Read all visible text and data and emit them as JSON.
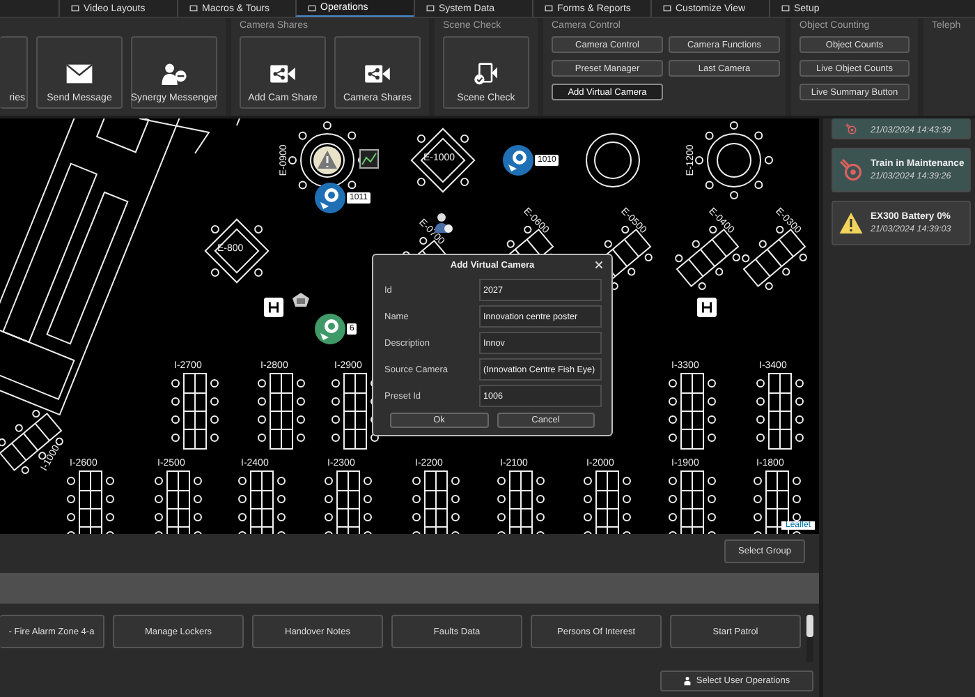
{
  "tabs": [
    {
      "label": "Video Layouts",
      "selected": false
    },
    {
      "label": "Macros & Tours",
      "selected": false
    },
    {
      "label": "Operations",
      "selected": true
    },
    {
      "label": "System Data",
      "selected": false
    },
    {
      "label": "Forms & Reports",
      "selected": false
    },
    {
      "label": "Customize View",
      "selected": false
    },
    {
      "label": "Setup",
      "selected": false
    }
  ],
  "ribbon": [
    {
      "kind": "large",
      "buttons": [
        {
          "label": "ries"
        },
        {
          "label": "Send Message"
        },
        {
          "label": "Synergy Messenger"
        }
      ]
    },
    {
      "kind": "large",
      "title": "Camera Shares",
      "buttons": [
        {
          "label": "Add Cam Share"
        },
        {
          "label": "Camera Shares"
        }
      ]
    },
    {
      "kind": "large",
      "title": "Scene Check",
      "buttons": [
        {
          "label": "Scene Check"
        }
      ]
    },
    {
      "kind": "small",
      "title": "Camera Control",
      "buttons": [
        {
          "label": "Camera Control",
          "selected": false
        },
        {
          "label": "Camera Functions",
          "selected": false
        },
        {
          "label": "Preset Manager",
          "selected": false
        },
        {
          "label": "Last Camera",
          "selected": false
        },
        {
          "label": "Add Virtual Camera",
          "selected": true
        }
      ]
    },
    {
      "kind": "column",
      "title": "Object Counting",
      "buttons": [
        {
          "label": "Object Counts",
          "selected": false
        },
        {
          "label": "Live Object Counts",
          "selected": false
        },
        {
          "label": "Live Summary Button",
          "selected": false
        }
      ]
    },
    {
      "kind": "column",
      "title": "Teleph"
    }
  ],
  "map": {
    "tables": [
      {
        "kind": "round",
        "label": "E-0900"
      },
      {
        "kind": "diamond",
        "label": "E-1000"
      },
      {
        "kind": "round",
        "label": "E-1200"
      },
      {
        "kind": "diamond",
        "label": "E-800"
      },
      {
        "kind": "angled",
        "label": "E-0700"
      },
      {
        "kind": "angled",
        "label": "E-0600"
      },
      {
        "kind": "angled",
        "label": "E-0500"
      },
      {
        "kind": "angled",
        "label": "E-0400"
      },
      {
        "kind": "angled",
        "label": "E-0300"
      },
      {
        "kind": "long",
        "label": "I-2700"
      },
      {
        "kind": "long",
        "label": "I-2800"
      },
      {
        "kind": "long",
        "label": "I-2900"
      },
      {
        "kind": "long",
        "label": "I-3300"
      },
      {
        "kind": "long",
        "label": "I-3400"
      },
      {
        "kind": "long",
        "label": "I-2600"
      },
      {
        "kind": "long",
        "label": "I-2500"
      },
      {
        "kind": "long",
        "label": "I-2400"
      },
      {
        "kind": "long",
        "label": "I-2300"
      },
      {
        "kind": "long",
        "label": "I-2200"
      },
      {
        "kind": "long",
        "label": "I-2100"
      },
      {
        "kind": "long",
        "label": "I-2000"
      },
      {
        "kind": "long",
        "label": "I-1900"
      },
      {
        "kind": "long",
        "label": "I-1800"
      },
      {
        "kind": "slanted",
        "label": "I-1000"
      }
    ],
    "pins": [
      {
        "label": "1011",
        "color": "#1f6fb5"
      },
      {
        "label": "1010",
        "color": "#1f6fb5"
      },
      {
        "label": "6",
        "color": "#3f9a68"
      }
    ],
    "attribution": "Leaflet"
  },
  "dialog": {
    "title": "Add Virtual Camera",
    "fields": [
      {
        "label": "Id",
        "value": "2027"
      },
      {
        "label": "Name",
        "value": "Innovation centre poster"
      },
      {
        "label": "Description",
        "value": "Innov"
      },
      {
        "label": "Source Camera",
        "value": "(Innovation Centre Fish Eye)"
      },
      {
        "label": "Preset Id",
        "value": "1006"
      }
    ],
    "buttons": [
      "Ok",
      "Cancel"
    ]
  },
  "group_button": "Select Group",
  "operations": [
    "- Fire Alarm Zone 4-a",
    "Manage Lockers",
    "Handover Notes",
    "Faults Data",
    "Persons Of Interest",
    "Start Patrol"
  ],
  "user_operations_button": "Select User Operations",
  "alerts": [
    {
      "kind": "maintenance",
      "time": "21/03/2024 14:43:39"
    },
    {
      "kind": "maintenance",
      "title": "Train in Maintenance",
      "time": "21/03/2024 14:39:26"
    },
    {
      "kind": "warning",
      "title": "EX300 Battery 0%",
      "time": "21/03/2024 14:39:03"
    }
  ]
}
